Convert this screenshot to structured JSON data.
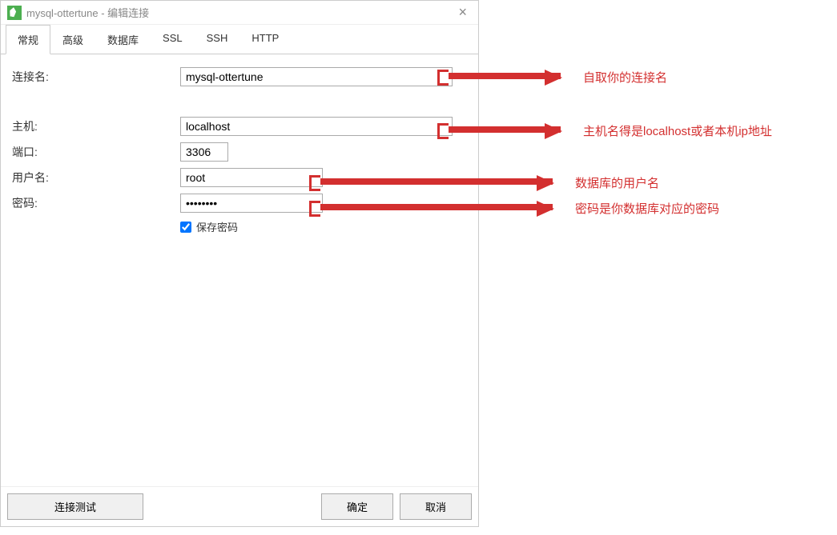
{
  "window": {
    "title": "mysql-ottertune - 编辑连接"
  },
  "tabs": [
    {
      "label": "常规",
      "active": true
    },
    {
      "label": "高级",
      "active": false
    },
    {
      "label": "数据库",
      "active": false
    },
    {
      "label": "SSL",
      "active": false
    },
    {
      "label": "SSH",
      "active": false
    },
    {
      "label": "HTTP",
      "active": false
    }
  ],
  "form": {
    "connection_name_label": "连接名:",
    "connection_name_value": "mysql-ottertune",
    "host_label": "主机:",
    "host_value": "localhost",
    "port_label": "端口:",
    "port_value": "3306",
    "username_label": "用户名:",
    "username_value": "root",
    "password_label": "密码:",
    "password_value": "••••••••",
    "save_password_label": "保存密码",
    "save_password_checked": true
  },
  "footer": {
    "test_connection": "连接测试",
    "ok": "确定",
    "cancel": "取消"
  },
  "annotations": [
    {
      "text": "自取你的连接名"
    },
    {
      "text": "主机名得是localhost或者本机ip地址"
    },
    {
      "text": "数据库的用户名"
    },
    {
      "text": "密码是你数据库对应的密码"
    }
  ]
}
